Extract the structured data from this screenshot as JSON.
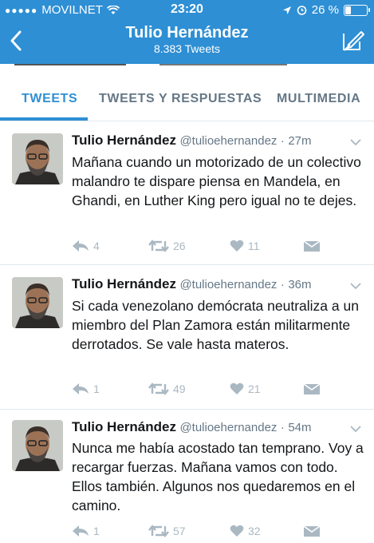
{
  "status_bar": {
    "signal": "●●●●●",
    "carrier": "MOVILNET",
    "time": "23:20",
    "battery_percent": "26 %",
    "icons": [
      "wifi-icon",
      "location-icon",
      "alarm-icon",
      "battery-icon"
    ]
  },
  "nav": {
    "title": "Tulio Hernández",
    "subtitle": "8.383 Tweets",
    "icons": [
      "back-chevron-icon",
      "compose-icon"
    ]
  },
  "tabs": [
    {
      "label": "TWEETS",
      "active": true
    },
    {
      "label": "TWEETS Y RESPUESTAS",
      "active": false
    },
    {
      "label": "MULTIMEDIA",
      "active": false
    }
  ],
  "colors": {
    "brand": "#2e8fd4",
    "muted": "#657786",
    "action": "#aab8c2"
  },
  "tweets": [
    {
      "name": "Tulio Hernández",
      "handle": "@tulioehernandez",
      "sep": "·",
      "time": "27m",
      "text": "Mañana cuando un motorizado de un colectivo malandro  te dispare piensa en Mandela, en Ghandi, en Luther King pero igual no te dejes.",
      "replies": "4",
      "retweets": "26",
      "likes": "11"
    },
    {
      "name": "Tulio Hernández",
      "handle": "@tulioehernandez",
      "sep": "·",
      "time": "36m",
      "text": "Si cada venezolano demócrata neutraliza a un miembro del Plan Zamora están militarmente derrotados. Se vale hasta materos.",
      "replies": "1",
      "retweets": "49",
      "likes": "21"
    },
    {
      "name": "Tulio Hernández",
      "handle": "@tulioehernandez",
      "sep": "·",
      "time": "54m",
      "text": "Nunca me había acostado tan temprano. Voy a recargar fuerzas. Mañana vamos con todo. Ellos también. Algunos nos quedaremos en el camino.",
      "replies": "1",
      "retweets": "57",
      "likes": "32"
    }
  ]
}
